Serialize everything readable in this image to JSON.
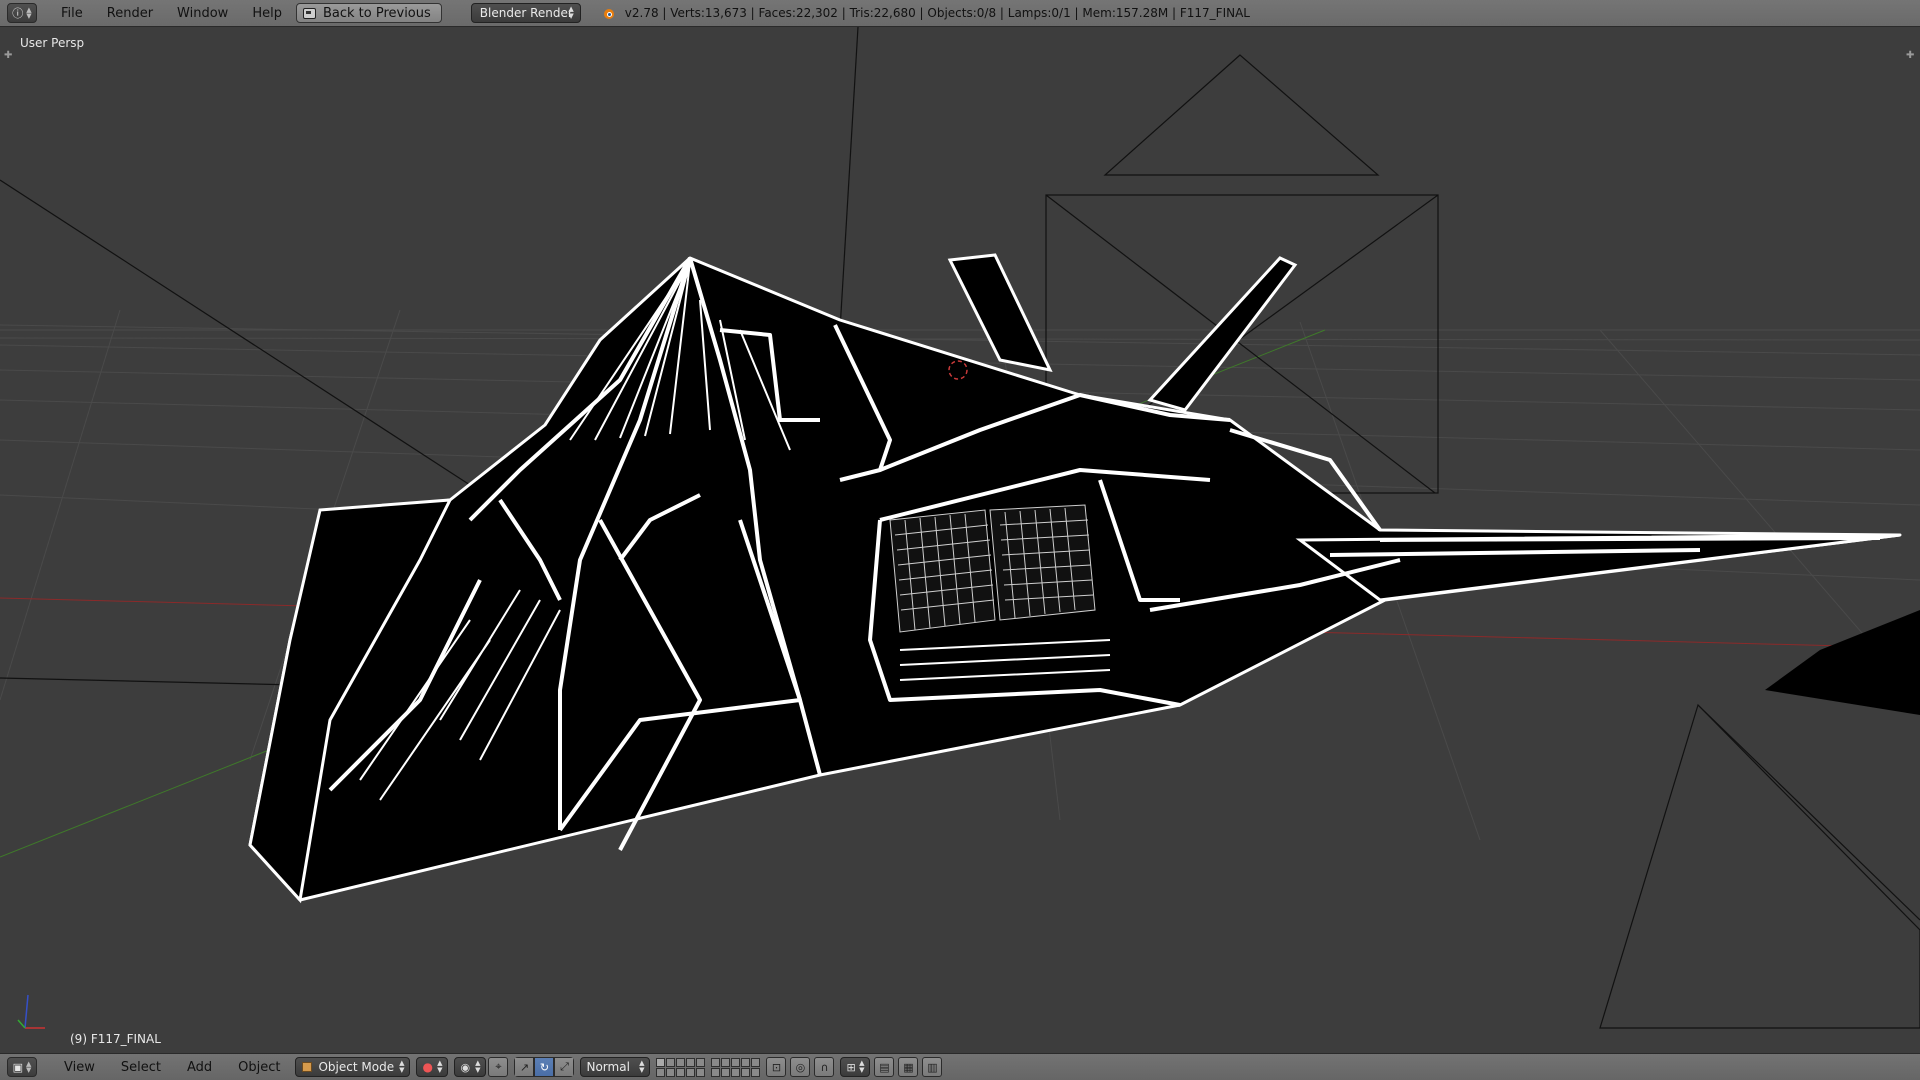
{
  "top_bar": {
    "editor_type_icon": "info-icon",
    "menus": [
      "File",
      "Render",
      "Window",
      "Help"
    ],
    "back_button": "Back to Previous",
    "render_engine": "Blender Render",
    "stats": "v2.78 | Verts:13,673 | Faces:22,302 | Tris:22,680 | Objects:0/8 | Lamps:0/1 | Mem:157.28M | F117_FINAL"
  },
  "viewport": {
    "view_label": "User Persp",
    "active_object_label": "(9) F117_FINAL"
  },
  "bottom_bar": {
    "editor_type_icon": "view3d-icon",
    "menus": [
      "View",
      "Select",
      "Add",
      "Object"
    ],
    "mode": "Object Mode",
    "transform_orientation": "Normal"
  },
  "colors": {
    "header": "#727272",
    "viewport_bg": "#3d3d3d",
    "selected_tool": "#5b7fb5",
    "x_axis": "#8b2a2a",
    "y_axis": "#3f7a2a"
  }
}
